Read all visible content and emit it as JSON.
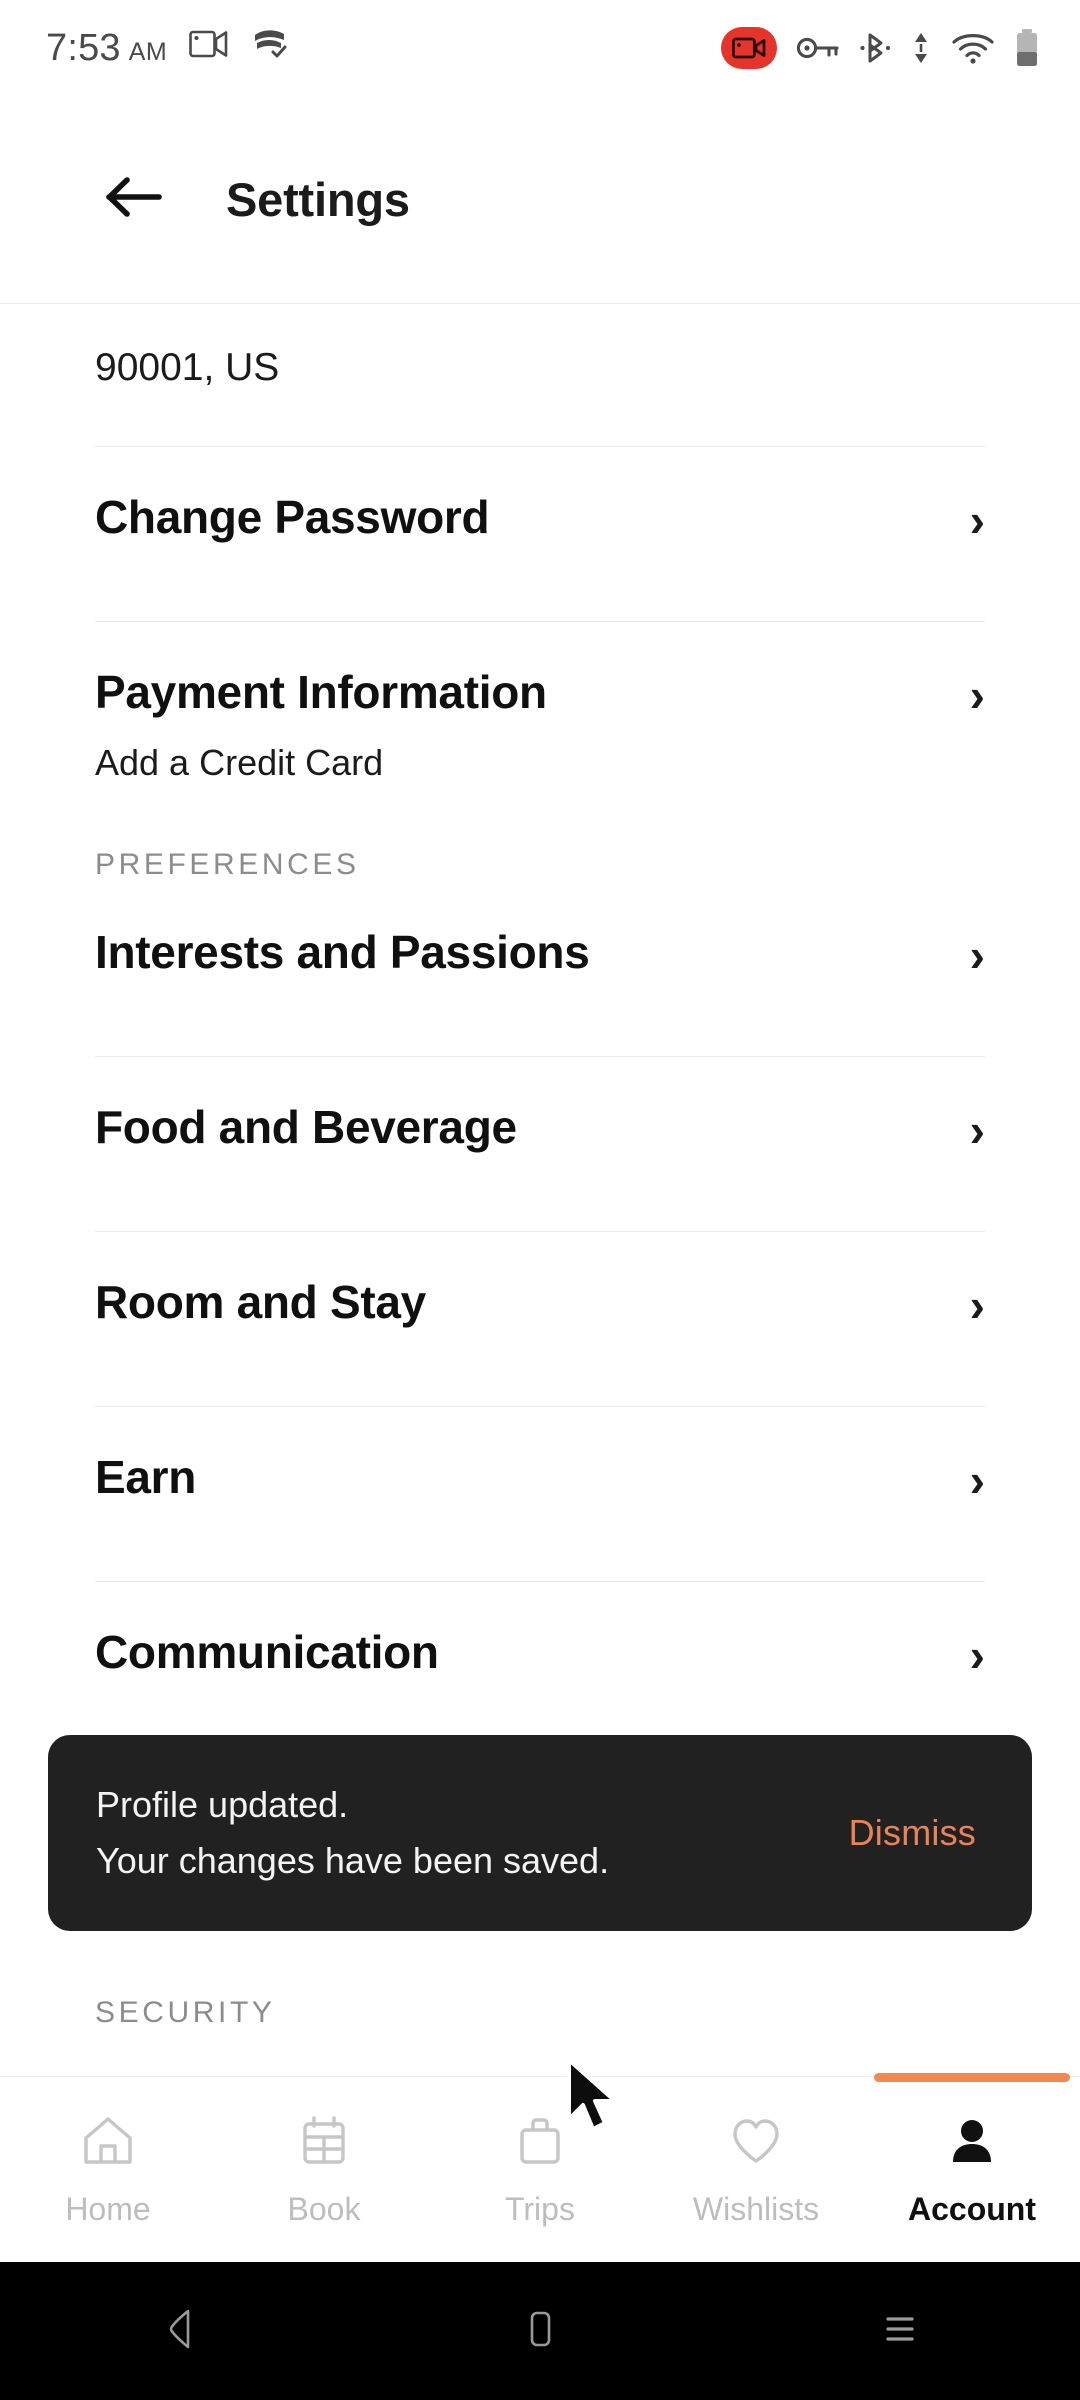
{
  "status_bar": {
    "time": "7:53",
    "am_pm": "AM",
    "icons": [
      "screen-cast-icon",
      "vpn-shield-check-icon",
      "screen-record-badge-icon",
      "vpn-key-icon",
      "bluetooth-icon",
      "data-transfer-icon",
      "wifi-icon",
      "battery-icon"
    ]
  },
  "header": {
    "back_icon": "arrow-left-icon",
    "title": "Settings"
  },
  "content": {
    "address_line": "90001, US",
    "rows": [
      {
        "title": "Change Password",
        "subtitle": "",
        "chevron": "›"
      },
      {
        "title": "Payment Information",
        "subtitle": "Add a Credit Card",
        "chevron": "›"
      }
    ],
    "preferences_header": "PREFERENCES",
    "preference_rows": [
      {
        "title": "Interests and Passions",
        "chevron": "›"
      },
      {
        "title": "Food and Beverage",
        "chevron": "›"
      },
      {
        "title": "Room and Stay",
        "chevron": "›"
      },
      {
        "title": "Earn",
        "chevron": "›"
      },
      {
        "title": "Communication",
        "chevron": "›"
      }
    ],
    "security_header": "SECURITY"
  },
  "snackbar": {
    "line1": "Profile updated.",
    "line2": "Your changes have been saved.",
    "action_label": "Dismiss",
    "action_color": "#e8845a",
    "background_color": "#212121"
  },
  "bottom_nav": {
    "active_index": 4,
    "indicator_color": "#f08a50",
    "items": [
      {
        "label": "Home",
        "icon": "home-icon"
      },
      {
        "label": "Book",
        "icon": "calendar-icon"
      },
      {
        "label": "Trips",
        "icon": "briefcase-icon"
      },
      {
        "label": "Wishlists",
        "icon": "heart-icon"
      },
      {
        "label": "Account",
        "icon": "person-icon"
      }
    ]
  },
  "system_nav": {
    "back": "triangle-back-icon",
    "home": "square-home-icon",
    "recents": "menu-recents-icon"
  }
}
